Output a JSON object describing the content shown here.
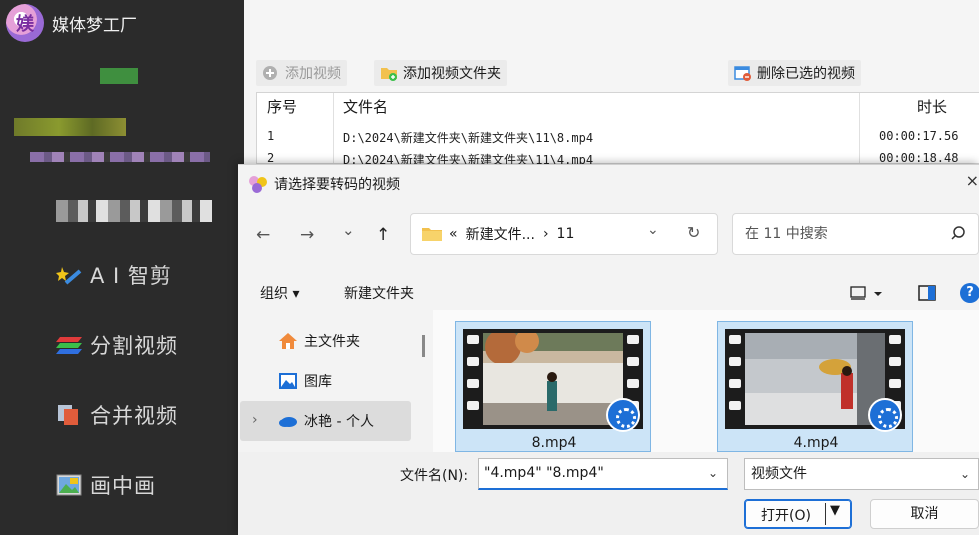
{
  "sidebar": {
    "app_logo_char": "媄",
    "app_title": "媒体梦工厂",
    "nav": [
      {
        "label": "A I 智剪",
        "icon": "magic-wand-icon"
      },
      {
        "label": "分割视频",
        "icon": "split-layers-icon"
      },
      {
        "label": "合并视频",
        "icon": "merge-layers-icon"
      },
      {
        "label": "画中画",
        "icon": "picture-in-picture-icon"
      }
    ]
  },
  "main": {
    "toolbar": {
      "add_video": "添加视频",
      "add_folder": "添加视频文件夹",
      "delete_selected": "删除已选的视频"
    },
    "table": {
      "columns": [
        "序号",
        "文件名",
        "时长"
      ],
      "rows": [
        {
          "index": "1",
          "path": "D:\\2024\\新建文件夹\\新建文件夹\\11\\8.mp4",
          "duration": "00:00:17.56"
        },
        {
          "index": "2",
          "path": "D:\\2024\\新建文件夹\\新建文件夹\\11\\4.mp4",
          "duration": "00:00:18.48"
        }
      ]
    }
  },
  "dialog": {
    "title": "请选择要转码的视频",
    "close": "×",
    "nav": {
      "back": "←",
      "forward": "→",
      "recent": "⌄",
      "up": "↑",
      "refresh": "↻"
    },
    "address": {
      "prefix": "«",
      "crumb1": "新建文件...",
      "sep": "›",
      "crumb2": "11",
      "dropdown": "⌄"
    },
    "search_placeholder": "在 11 中搜索",
    "commands": {
      "organize": "组织 ▾",
      "new_folder": "新建文件夹"
    },
    "tree": [
      {
        "label": "主文件夹",
        "icon": "home-icon"
      },
      {
        "label": "图库",
        "icon": "gallery-icon"
      },
      {
        "label": "冰艳 - 个人",
        "icon": "onedrive-cloud-icon",
        "expander": "›"
      }
    ],
    "files": [
      {
        "name": "8.mp4"
      },
      {
        "name": "4.mp4"
      }
    ],
    "filename_label": "文件名(N):",
    "filename_value": "\"4.mp4\" \"8.mp4\"",
    "filetype_value": "视频文件",
    "open_label": "打开(O)",
    "cancel_label": "取消"
  },
  "colors": {
    "sidebar_bg": "#2b2b2b",
    "accent_blue": "#1d6fd6",
    "selection_bg": "#cce4f7"
  }
}
